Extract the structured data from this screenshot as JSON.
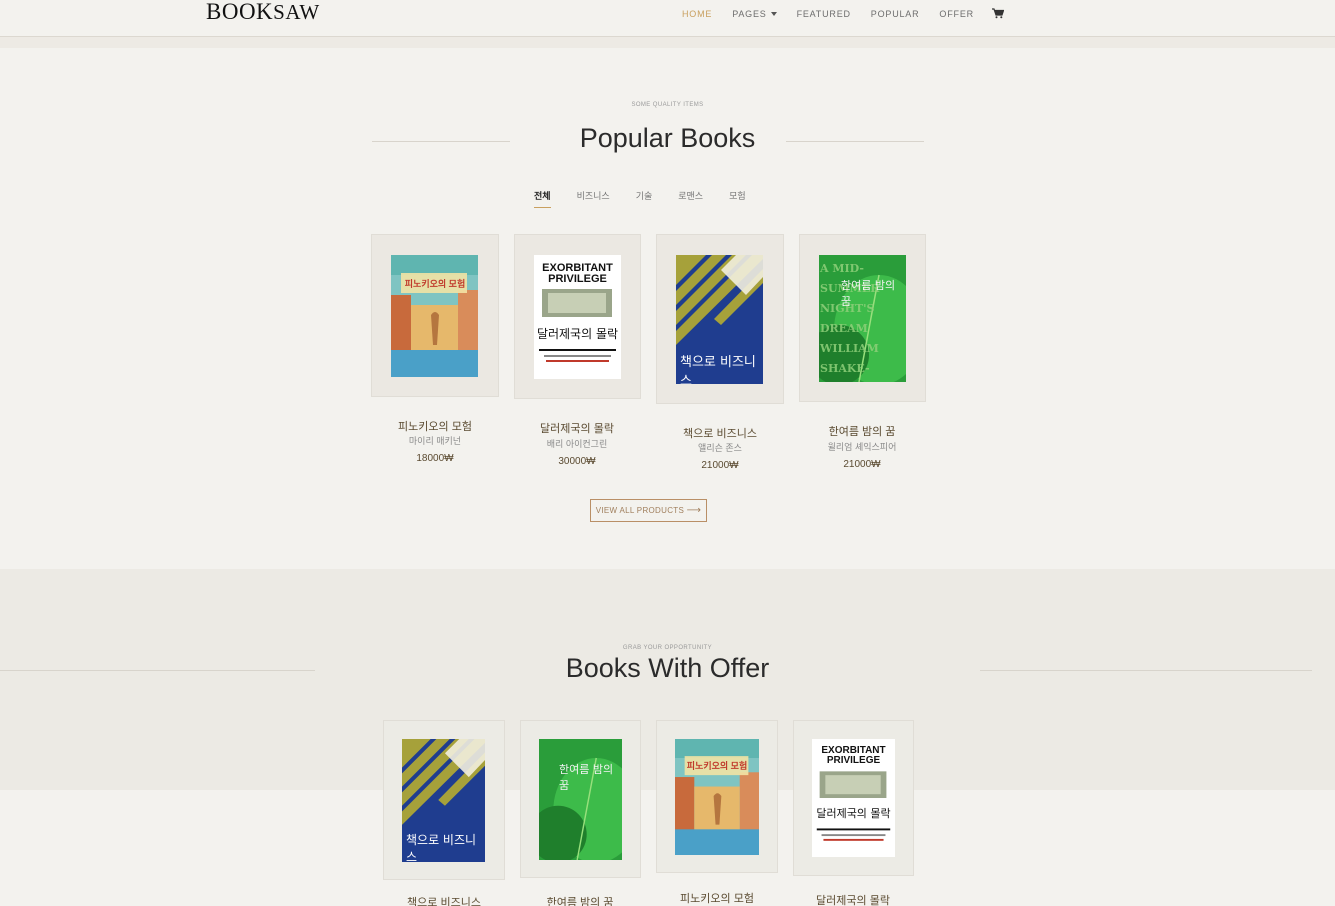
{
  "header": {
    "logo_main": "BOOK",
    "logo_tail": "SAW",
    "nav": [
      {
        "label": "HOME"
      },
      {
        "label": "PAGES"
      },
      {
        "label": "FEATURED"
      },
      {
        "label": "POPULAR"
      },
      {
        "label": "OFFER"
      }
    ],
    "cart_icon": "cart-icon",
    "accent_color": "#c9a05f"
  },
  "popular": {
    "kicker": "SOME QUALITY ITEMS",
    "title": "Popular Books",
    "tabs": [
      "전체",
      "비즈니스",
      "기술",
      "로맨스",
      "모험"
    ],
    "active_tab": "전체",
    "books": [
      {
        "title": "피노키오의 모험",
        "author": "마이리 매키넌",
        "price": "18000₩",
        "cover_text": "피노키오의 모험"
      },
      {
        "title": "달러제국의 몰락",
        "author": "배리 아이컨그린",
        "price": "30000₩",
        "cover_text": "EXORBITANT PRIVILEGE"
      },
      {
        "title": "책으로 비즈니스",
        "author": "앨리슨 존스",
        "price": "21000₩",
        "cover_text": "책으로 비즈니스"
      },
      {
        "title": "한여름 밤의 꿈",
        "author": "윌리엄 셰익스피어",
        "price": "21000₩",
        "cover_text": "A MID-SUMMER NIGHT'S DREAM WILLIAM SHAKE-SPEARE"
      }
    ],
    "view_all": "VIEW ALL PRODUCTS"
  },
  "offer": {
    "kicker": "GRAB YOUR OPPORTUNITY",
    "title": "Books With Offer",
    "books": [
      {
        "title": "책으로 비즈니스"
      },
      {
        "title": "한여름 밤의 꿈"
      },
      {
        "title": "피노키오의 모험"
      },
      {
        "title": "달러제국의 몰락"
      }
    ]
  }
}
